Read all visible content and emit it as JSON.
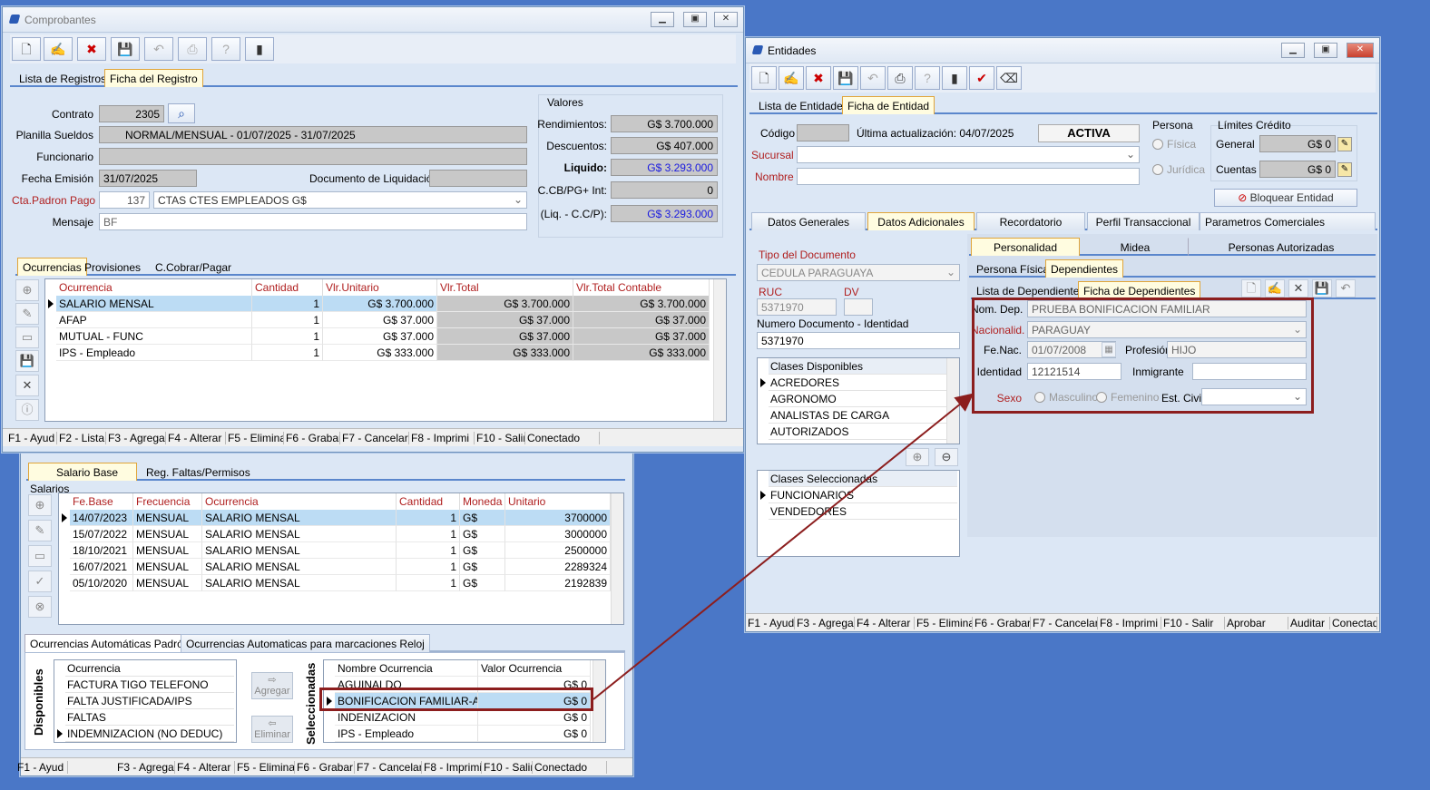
{
  "comprobantes": {
    "title": "Comprobantes",
    "tabs": [
      "Lista de Registros",
      "Ficha del Registro"
    ],
    "contrato_label": "Contrato",
    "contrato": "2305",
    "planilla_label": "Planilla Sueldos",
    "planilla": "NORMAL/MENSUAL - 01/07/2025 - 31/07/2025",
    "funcionario_label": "Funcionario",
    "fecha_label": "Fecha Emisión",
    "fecha": "31/07/2025",
    "doc_label": "Documento de Liquidación",
    "cta_label": "Cta.Padron Pago",
    "cta_num": "137",
    "cta_text": "CTAS CTES EMPLEADOS G$",
    "mensaje_label": "Mensaje",
    "mensaje": "BF",
    "valores_title": "Valores",
    "rend_label": "Rendimientos:",
    "rend": "G$ 3.700.000",
    "desc_label": "Descuentos:",
    "desc": "G$ 407.000",
    "liq_label": "Liquido:",
    "liq": "G$ 3.293.000",
    "ccb_label": "C.CB/PG+ Int:",
    "ccb": "0",
    "liqcc_label": "(Liq. - C.C/P):",
    "liqcc": "G$ 3.293.000",
    "subtabs": [
      "Ocurrencias",
      "Provisiones",
      "C.Cobrar/Pagar"
    ],
    "grid_headers": [
      "Ocurrencia",
      "Cantidad",
      "Vlr.Unitario",
      "Vlr.Total",
      "Vlr.Total Contable"
    ],
    "grid_rows": [
      [
        "SALARIO MENSAL",
        "1",
        "G$ 3.700.000",
        "G$ 3.700.000",
        "G$ 3.700.000"
      ],
      [
        "AFAP",
        "1",
        "G$ 37.000",
        "G$ 37.000",
        "G$ 37.000"
      ],
      [
        "MUTUAL - FUNC",
        "1",
        "G$ 37.000",
        "G$ 37.000",
        "G$ 37.000"
      ],
      [
        "IPS - Empleado",
        "1",
        "G$ 333.000",
        "G$ 333.000",
        "G$ 333.000"
      ]
    ],
    "status": [
      "F1 - Ayud",
      "F2 - Lista",
      "F3 - Agrega",
      "F4 - Alterar",
      "F5 - Elimina",
      "F6 - Grabar",
      "F7 - Cancelar",
      "F8 - Imprimi",
      "F10 - Salir",
      "Conectado"
    ]
  },
  "lower": {
    "tabs": [
      "Salario Base",
      "Reg. Faltas/Permisos"
    ],
    "salarios_label": "Salarios",
    "headers": [
      "Fe.Base",
      "Frecuencia",
      "Ocurrencia",
      "Cantidad",
      "Moneda",
      "Unitario"
    ],
    "rows": [
      [
        "14/07/2023",
        "MENSUAL",
        "SALARIO MENSAL",
        "1",
        "G$",
        "3700000"
      ],
      [
        "15/07/2022",
        "MENSUAL",
        "SALARIO MENSAL",
        "1",
        "G$",
        "3000000"
      ],
      [
        "18/10/2021",
        "MENSUAL",
        "SALARIO MENSAL",
        "1",
        "G$",
        "2500000"
      ],
      [
        "16/07/2021",
        "MENSUAL",
        "SALARIO MENSAL",
        "1",
        "G$",
        "2289324"
      ],
      [
        "05/10/2020",
        "MENSUAL",
        "SALARIO MENSAL",
        "1",
        "G$",
        "2192839"
      ]
    ],
    "occ_tabs": [
      "Ocurrencias Automáticas Padrón",
      "Ocurrencias Automaticas para marcaciones Reloj"
    ],
    "disponibles_label": "Disponibles",
    "seleccionadas_label": "Seleccionadas",
    "disp_header": "Ocurrencia",
    "disp_items": [
      "FACTURA TIGO TELEFONO",
      "FALTA JUSTIFICADA/IPS",
      "FALTAS",
      "INDEMNIZACION (NO DEDUC)"
    ],
    "agregar": "Agregar",
    "eliminar": "Eliminar",
    "sel_headers": [
      "Nombre Ocurrencia",
      "Valor Ocurrencia"
    ],
    "sel_rows": [
      [
        "AGUINALDO",
        "G$ 0"
      ],
      [
        "BONIFICACION FAMILIAR-ART.",
        "G$ 0"
      ],
      [
        "INDENIZACION",
        "G$ 0"
      ],
      [
        "IPS - Empleado",
        "G$ 0"
      ]
    ],
    "status": [
      "F1 - Ayud",
      "F3 - Agrega",
      "F4 - Alterar",
      "F5 - Elimina",
      "F6 - Grabar",
      "F7 - Cancelar",
      "F8 - Imprimi",
      "F10 - Salir",
      "Conectado"
    ]
  },
  "entidades": {
    "title": "Entidades",
    "tabs": [
      "Lista de Entidades",
      "Ficha de Entidad"
    ],
    "codigo_label": "Código",
    "ultima": "Última actualización: 04/07/2025",
    "estado": "ACTIVA",
    "sucursal_label": "Sucursal",
    "nombre_label": "Nombre",
    "persona_title": "Persona",
    "fisica": "Física",
    "juridica": "Jurídica",
    "limites_title": "Límites Crédito",
    "general_label": "General",
    "general": "G$ 0",
    "cuentas_label": "Cuentas",
    "cuentas": "G$ 0",
    "bloquear": "Bloquear Entidad",
    "main_tabs": [
      "Datos Generales",
      "Datos Adicionales",
      "Recordatorio",
      "Perfil Transaccional",
      "Parametros Comerciales"
    ],
    "tipo_doc_label": "Tipo del Documento",
    "tipo_doc": "CEDULA PARAGUAYA",
    "ruc_label": "RUC",
    "ruc": "5371970",
    "dv_label": "DV",
    "numdoc_label": "Numero Documento - Identidad",
    "numdoc": "5371970",
    "clases_disp_title": "Clases Disponibles",
    "clases_disp": [
      "ACREDORES",
      "AGRONOMO",
      "ANALISTAS DE CARGA",
      "AUTORIZADOS"
    ],
    "clases_sel_title": "Clases Seleccionadas",
    "clases_sel": [
      "FUNCIONARIOS",
      "VENDEDORES"
    ],
    "pers_tabs": [
      "Personalidad",
      "Midea",
      "Personas Autorizadas"
    ],
    "pf_tabs": [
      "Persona Física",
      "Dependientes"
    ],
    "dep_tabs": [
      "Lista de Dependientes",
      "Ficha de Dependientes"
    ],
    "nomdep_label": "Nom. Dep.",
    "nomdep": "PRUEBA BONIFICACION FAMILIAR",
    "nac_label": "Nacionalid.",
    "nac": "PARAGUAY",
    "fenac_label": "Fe.Nac.",
    "fenac": "01/07/2008",
    "prof_label": "Profesión",
    "prof": "HIJO",
    "ident_label": "Identidad",
    "ident": "12121514",
    "inmig_label": "Inmigrante",
    "sexo_label": "Sexo",
    "masc": "Masculino",
    "fem": "Femenino",
    "civil_label": "Est. Civil",
    "status": [
      "F1 - Ayud",
      "F3 - Agrega",
      "F4 - Alterar",
      "F5 - Elimina",
      "F6 - Grabar",
      "F7 - Cancelar",
      "F8 - Imprimi",
      "F10 - Salir",
      "Aprobar",
      "Auditar",
      "Conectad"
    ]
  },
  "colors": {
    "desktop": "#4a77c7",
    "arrow": "#8c1e1e",
    "highlight": "#bcdcf4",
    "label_red": "#b02020"
  }
}
